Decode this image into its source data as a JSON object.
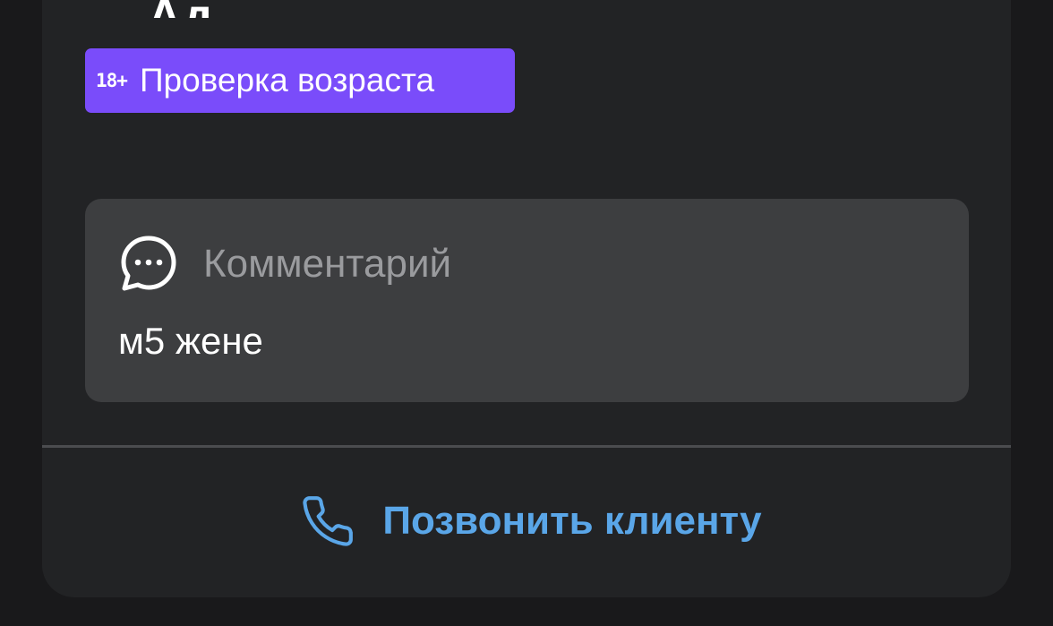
{
  "header": {
    "title_fragment": "Ад"
  },
  "age_badge": {
    "icon_text": "18+",
    "label": "Проверка возраста",
    "color": "#7a4cfa"
  },
  "comment": {
    "icon": "chat-bubble-icon",
    "title": "Комментарий",
    "text": "м5 жене"
  },
  "call": {
    "icon": "phone-icon",
    "label": "Позвонить клиенту",
    "color": "#5aa6e8"
  }
}
